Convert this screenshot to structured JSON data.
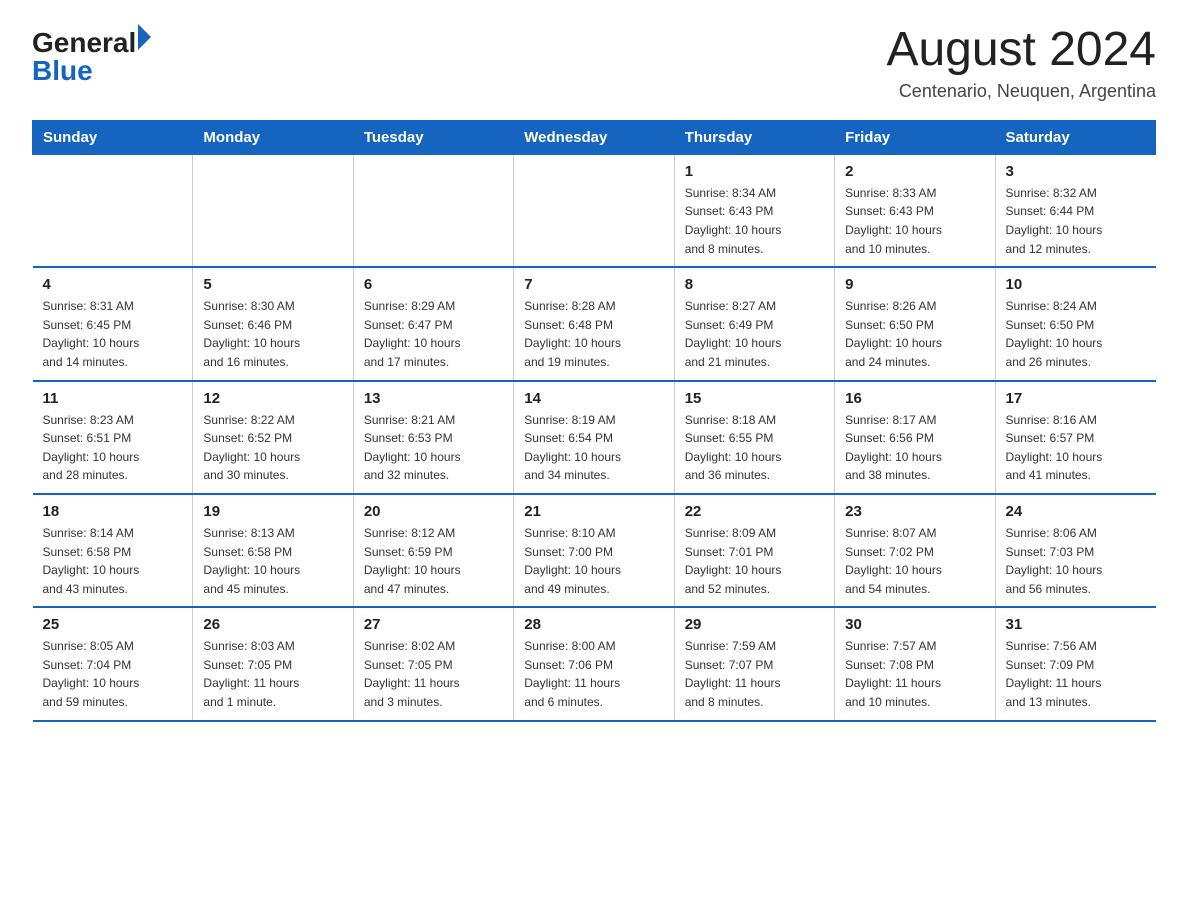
{
  "header": {
    "logo_general": "General",
    "logo_blue": "Blue",
    "month_title": "August 2024",
    "location": "Centenario, Neuquen, Argentina"
  },
  "days_of_week": [
    "Sunday",
    "Monday",
    "Tuesday",
    "Wednesday",
    "Thursday",
    "Friday",
    "Saturday"
  ],
  "weeks": [
    [
      {
        "num": "",
        "info": ""
      },
      {
        "num": "",
        "info": ""
      },
      {
        "num": "",
        "info": ""
      },
      {
        "num": "",
        "info": ""
      },
      {
        "num": "1",
        "info": "Sunrise: 8:34 AM\nSunset: 6:43 PM\nDaylight: 10 hours\nand 8 minutes."
      },
      {
        "num": "2",
        "info": "Sunrise: 8:33 AM\nSunset: 6:43 PM\nDaylight: 10 hours\nand 10 minutes."
      },
      {
        "num": "3",
        "info": "Sunrise: 8:32 AM\nSunset: 6:44 PM\nDaylight: 10 hours\nand 12 minutes."
      }
    ],
    [
      {
        "num": "4",
        "info": "Sunrise: 8:31 AM\nSunset: 6:45 PM\nDaylight: 10 hours\nand 14 minutes."
      },
      {
        "num": "5",
        "info": "Sunrise: 8:30 AM\nSunset: 6:46 PM\nDaylight: 10 hours\nand 16 minutes."
      },
      {
        "num": "6",
        "info": "Sunrise: 8:29 AM\nSunset: 6:47 PM\nDaylight: 10 hours\nand 17 minutes."
      },
      {
        "num": "7",
        "info": "Sunrise: 8:28 AM\nSunset: 6:48 PM\nDaylight: 10 hours\nand 19 minutes."
      },
      {
        "num": "8",
        "info": "Sunrise: 8:27 AM\nSunset: 6:49 PM\nDaylight: 10 hours\nand 21 minutes."
      },
      {
        "num": "9",
        "info": "Sunrise: 8:26 AM\nSunset: 6:50 PM\nDaylight: 10 hours\nand 24 minutes."
      },
      {
        "num": "10",
        "info": "Sunrise: 8:24 AM\nSunset: 6:50 PM\nDaylight: 10 hours\nand 26 minutes."
      }
    ],
    [
      {
        "num": "11",
        "info": "Sunrise: 8:23 AM\nSunset: 6:51 PM\nDaylight: 10 hours\nand 28 minutes."
      },
      {
        "num": "12",
        "info": "Sunrise: 8:22 AM\nSunset: 6:52 PM\nDaylight: 10 hours\nand 30 minutes."
      },
      {
        "num": "13",
        "info": "Sunrise: 8:21 AM\nSunset: 6:53 PM\nDaylight: 10 hours\nand 32 minutes."
      },
      {
        "num": "14",
        "info": "Sunrise: 8:19 AM\nSunset: 6:54 PM\nDaylight: 10 hours\nand 34 minutes."
      },
      {
        "num": "15",
        "info": "Sunrise: 8:18 AM\nSunset: 6:55 PM\nDaylight: 10 hours\nand 36 minutes."
      },
      {
        "num": "16",
        "info": "Sunrise: 8:17 AM\nSunset: 6:56 PM\nDaylight: 10 hours\nand 38 minutes."
      },
      {
        "num": "17",
        "info": "Sunrise: 8:16 AM\nSunset: 6:57 PM\nDaylight: 10 hours\nand 41 minutes."
      }
    ],
    [
      {
        "num": "18",
        "info": "Sunrise: 8:14 AM\nSunset: 6:58 PM\nDaylight: 10 hours\nand 43 minutes."
      },
      {
        "num": "19",
        "info": "Sunrise: 8:13 AM\nSunset: 6:58 PM\nDaylight: 10 hours\nand 45 minutes."
      },
      {
        "num": "20",
        "info": "Sunrise: 8:12 AM\nSunset: 6:59 PM\nDaylight: 10 hours\nand 47 minutes."
      },
      {
        "num": "21",
        "info": "Sunrise: 8:10 AM\nSunset: 7:00 PM\nDaylight: 10 hours\nand 49 minutes."
      },
      {
        "num": "22",
        "info": "Sunrise: 8:09 AM\nSunset: 7:01 PM\nDaylight: 10 hours\nand 52 minutes."
      },
      {
        "num": "23",
        "info": "Sunrise: 8:07 AM\nSunset: 7:02 PM\nDaylight: 10 hours\nand 54 minutes."
      },
      {
        "num": "24",
        "info": "Sunrise: 8:06 AM\nSunset: 7:03 PM\nDaylight: 10 hours\nand 56 minutes."
      }
    ],
    [
      {
        "num": "25",
        "info": "Sunrise: 8:05 AM\nSunset: 7:04 PM\nDaylight: 10 hours\nand 59 minutes."
      },
      {
        "num": "26",
        "info": "Sunrise: 8:03 AM\nSunset: 7:05 PM\nDaylight: 11 hours\nand 1 minute."
      },
      {
        "num": "27",
        "info": "Sunrise: 8:02 AM\nSunset: 7:05 PM\nDaylight: 11 hours\nand 3 minutes."
      },
      {
        "num": "28",
        "info": "Sunrise: 8:00 AM\nSunset: 7:06 PM\nDaylight: 11 hours\nand 6 minutes."
      },
      {
        "num": "29",
        "info": "Sunrise: 7:59 AM\nSunset: 7:07 PM\nDaylight: 11 hours\nand 8 minutes."
      },
      {
        "num": "30",
        "info": "Sunrise: 7:57 AM\nSunset: 7:08 PM\nDaylight: 11 hours\nand 10 minutes."
      },
      {
        "num": "31",
        "info": "Sunrise: 7:56 AM\nSunset: 7:09 PM\nDaylight: 11 hours\nand 13 minutes."
      }
    ]
  ]
}
